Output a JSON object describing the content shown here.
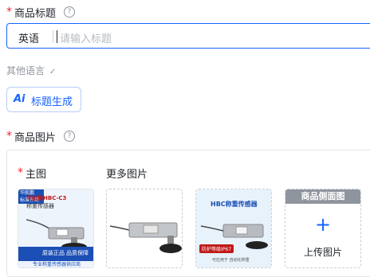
{
  "title_section": {
    "required_mark": "*",
    "label": "商品标题",
    "help_glyph": "?",
    "language": "英语",
    "placeholder": "请输入标题"
  },
  "other_language": {
    "label": "其他语言",
    "chevron": "✓"
  },
  "ai_button": {
    "icon_text": "Ai",
    "label": "标题生成"
  },
  "images_section": {
    "required_mark": "*",
    "label": "商品图片",
    "help_glyph": "?",
    "main_image": {
      "required_mark": "*",
      "label": "主图"
    },
    "more_images": {
      "label": "更多图片"
    },
    "side_view_slot": {
      "banner": "商品侧面图",
      "plus": "+",
      "upload_label": "上传图片"
    },
    "thumb1": {
      "brand_line": "华航鹏HBC-C3",
      "sub_line": "称重传感器",
      "tag": "华航鹏",
      "tag2": "标准件商",
      "footer_a": "原装正品",
      "footer_b": "品质保障",
      "bottom": "专业称重传感器供应商"
    },
    "thumb3": {
      "title": "HBC称重传感器",
      "badge": "防护等级IP67",
      "note": "可应用于 自动化称重"
    }
  }
}
